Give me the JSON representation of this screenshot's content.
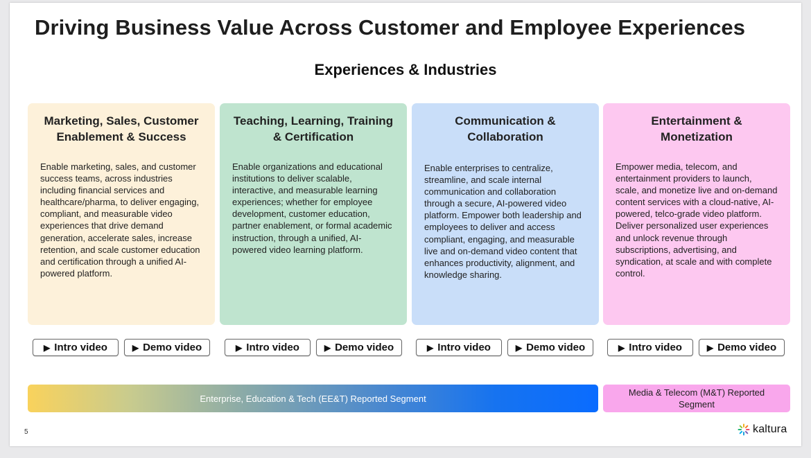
{
  "slide": {
    "title": "Driving Business Value Across Customer and Employee Experiences",
    "subtitle": "Experiences & Industries",
    "page_number": "5",
    "logo_text": "kaltura"
  },
  "cards": [
    {
      "title": "Marketing, Sales, Customer Enablement & Success",
      "body": "Enable marketing, sales, and customer success teams, across industries including financial services and healthcare/pharma, to deliver engaging, compliant, and measurable video experiences that drive demand generation, accelerate sales, increase retention, and scale customer education and certification through a unified AI-powered platform.",
      "color": "#fdf1da"
    },
    {
      "title": "Teaching, Learning, Training & Certification",
      "body": "Enable organizations and educational institutions to deliver scalable, interactive, and measurable learning experiences; whether for employee development, customer education, partner enablement, or formal academic instruction, through a unified, AI-powered video learning platform.",
      "color": "#bfe4cf"
    },
    {
      "title": "Communication & Collaboration",
      "body": "Enable enterprises to centralize, streamline, and scale internal communication and collaboration through a secure, AI-powered video platform. Empower both leadership and employees to deliver and access compliant, engaging, and measurable live and on-demand video content that enhances productivity, alignment, and knowledge sharing.",
      "color": "#c9def9"
    },
    {
      "title": "Entertainment & Monetization",
      "body": "Empower media, telecom, and entertainment providers to launch, scale, and monetize live and on-demand content services with a cloud-native, AI-powered, telco-grade video platform. Deliver personalized user experiences and unlock revenue through subscriptions, advertising, and syndication, at scale and with complete control.",
      "color": "#fdc8f0"
    }
  ],
  "buttons": {
    "intro_label": "Intro video",
    "demo_label": "Demo video",
    "icon": "play-icon"
  },
  "segments": {
    "eet": "Enterprise, Education & Tech (EE&T) Reported Segment",
    "mt": "Media & Telecom (M&T) Reported Segment"
  },
  "colors": {
    "mt_segment": "#f9a7ec",
    "eet_gradient_start": "#f9d25c",
    "eet_gradient_end": "#0a6cff"
  }
}
